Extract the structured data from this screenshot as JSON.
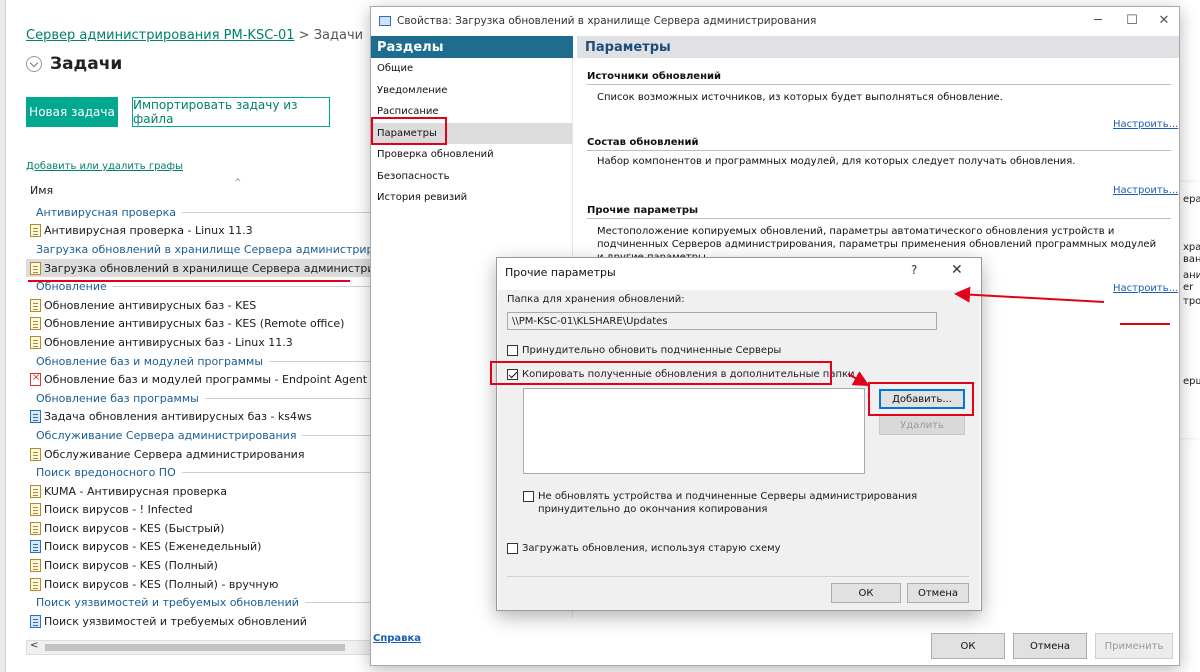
{
  "console": {
    "breadcrumb_link": "Сервер администрирования PM-KSC-01",
    "breadcrumb_sep": ">",
    "breadcrumb_current": "Задачи",
    "page_title": "Задачи",
    "new_task_label": "Новая задача",
    "import_task_label": "Импортировать задачу из файла",
    "columns_link": "Добавить или удалить графы",
    "column_name": "Имя",
    "rows": [
      {
        "type": "group",
        "label": "Антивирусная проверка"
      },
      {
        "type": "item",
        "label": "Антивирусная проверка - Linux 11.3",
        "icon": "task-icon"
      },
      {
        "type": "group",
        "label": "Загрузка обновлений в хранилище Сервера администрирования"
      },
      {
        "type": "item",
        "label": "Загрузка обновлений в хранилище Сервера администрирования",
        "icon": "task-icon",
        "selected": true
      },
      {
        "type": "group",
        "label": "Обновление"
      },
      {
        "type": "item",
        "label": "Обновление антивирусных баз - KES",
        "icon": "task-icon"
      },
      {
        "type": "item",
        "label": "Обновление антивирусных баз - KES (Remote office)",
        "icon": "task-icon"
      },
      {
        "type": "item",
        "label": "Обновление антивирусных баз - Linux 11.3",
        "icon": "task-icon"
      },
      {
        "type": "group",
        "label": "Обновление баз и модулей программы"
      },
      {
        "type": "item",
        "label": "Обновление баз и модулей программы - Endpoint Agent",
        "icon": "task-error-icon"
      },
      {
        "type": "group",
        "label": "Обновление баз программы"
      },
      {
        "type": "item",
        "label": "Задача обновления антивирусных баз - ks4ws",
        "icon": "task-blue-icon"
      },
      {
        "type": "group",
        "label": "Обслуживание Сервера администрирования"
      },
      {
        "type": "item",
        "label": "Обслуживание Сервера администрирования",
        "icon": "task-icon"
      },
      {
        "type": "group",
        "label": "Поиск вредоносного ПО"
      },
      {
        "type": "item",
        "label": "KUMA - Антивирусная проверка",
        "icon": "task-icon"
      },
      {
        "type": "item",
        "label": "Поиск вирусов - ! Infected",
        "icon": "task-icon"
      },
      {
        "type": "item",
        "label": "Поиск вирусов - KES (Быстрый)",
        "icon": "task-icon"
      },
      {
        "type": "item",
        "label": "Поиск вирусов - KES (Еженедельный)",
        "icon": "task-blue-icon"
      },
      {
        "type": "item",
        "label": "Поиск вирусов - KES (Полный)",
        "icon": "task-icon"
      },
      {
        "type": "item",
        "label": "Поиск вирусов - KES (Полный) - вручную",
        "icon": "task-icon"
      },
      {
        "type": "group",
        "label": "Поиск уязвимостей и требуемых обновлений"
      },
      {
        "type": "item",
        "label": "Поиск уязвимостей и требуемых обновлений",
        "icon": "task-blue-icon"
      }
    ],
    "right_fragments": [
      "ера",
      "хра",
      "ван",
      "ани",
      "er",
      "тро",
      "ерш"
    ]
  },
  "props": {
    "window_title": "Свойства: Загрузка обновлений в хранилище Сервера администрирования",
    "sections_header": "Разделы",
    "params_header": "Параметры",
    "sections": [
      "Общие",
      "Уведомление",
      "Расписание",
      "Параметры",
      "Проверка обновлений",
      "Безопасность",
      "История ревизий"
    ],
    "active_section": "Параметры",
    "blocks": {
      "sources_title": "Источники обновлений",
      "sources_desc": "Список возможных источников, из которых будет выполняться обновление.",
      "composition_title": "Состав обновлений",
      "composition_desc": "Набор компонентов и программных модулей, для которых следует получать обновления.",
      "other_title": "Прочие параметры",
      "other_desc": "Местоположение копируемых обновлений, параметры автоматического обновления устройств и подчиненных Серверов администрирования, параметры применения обновлений программных модулей и другие параметры.",
      "configure_link": "Настроить..."
    },
    "help_link": "Справка",
    "ok_label": "ОК",
    "cancel_label": "Отмена",
    "apply_label": "Применить"
  },
  "other_dialog": {
    "title": "Прочие параметры",
    "help_glyph": "?",
    "close_glyph": "✕",
    "folder_label": "Папка для хранения обновлений:",
    "folder_value": "\\\\PM-KSC-01\\KLSHARE\\Updates",
    "force_update_label": "Принудительно обновить подчиненные Серверы",
    "force_update_checked": false,
    "copy_label": "Копировать полученные обновления в дополнительные папки",
    "copy_checked": true,
    "add_label": "Добавить...",
    "remove_label": "Удалить",
    "no_force_label": "Не обновлять устройства и подчиненные Серверы администрирования принудительно до окончания копирования",
    "no_force_checked": false,
    "old_scheme_label": "Загружать обновления, используя старую схему",
    "old_scheme_checked": false,
    "ok_label": "ОК",
    "cancel_label": "Отмена"
  },
  "colors": {
    "accent_green": "#00a88e",
    "section_header": "#1e6d8e",
    "highlight_red": "#e3001b",
    "link_blue": "#1b5fb3"
  }
}
